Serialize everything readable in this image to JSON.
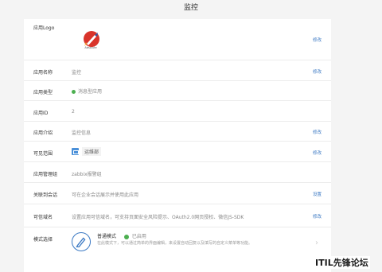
{
  "header": {
    "title": "监控"
  },
  "rows": {
    "logo": {
      "label": "应用Logo",
      "action": "修改",
      "logo_caption": "Absolute"
    },
    "name": {
      "label": "应用名称",
      "value": "监控",
      "action": "修改"
    },
    "type": {
      "label": "应用类型",
      "value": "消息型应用"
    },
    "id": {
      "label": "应用ID",
      "value": "2"
    },
    "intro": {
      "label": "应用介绍",
      "value": "监控信息",
      "action": "修改"
    },
    "scope": {
      "label": "可见范围",
      "value": "运维部",
      "action": "修改"
    },
    "admin": {
      "label": "应用管理组",
      "value": "zabbix报警组"
    },
    "session": {
      "label": "关联到会话",
      "value": "可在企业会话展示并使用此应用",
      "action": "设置"
    },
    "domain": {
      "label": "可信域名",
      "value": "设置应用可信域名，可支持页面安全风险提示、OAuth2.0网页授权、微信JS-SDK",
      "action": "修改"
    },
    "mode": {
      "label": "模式选择",
      "title": "普通模式",
      "status": "已启用",
      "desc": "在此模式下，可以通过简单的界面编辑，来设置自动回复以及填写的自定义菜单等功能。"
    }
  },
  "watermark": "ITIL先锋论坛",
  "colors": {
    "link": "#3a78c3",
    "enabled": "#4caf50",
    "folder": "#4a90d9"
  }
}
